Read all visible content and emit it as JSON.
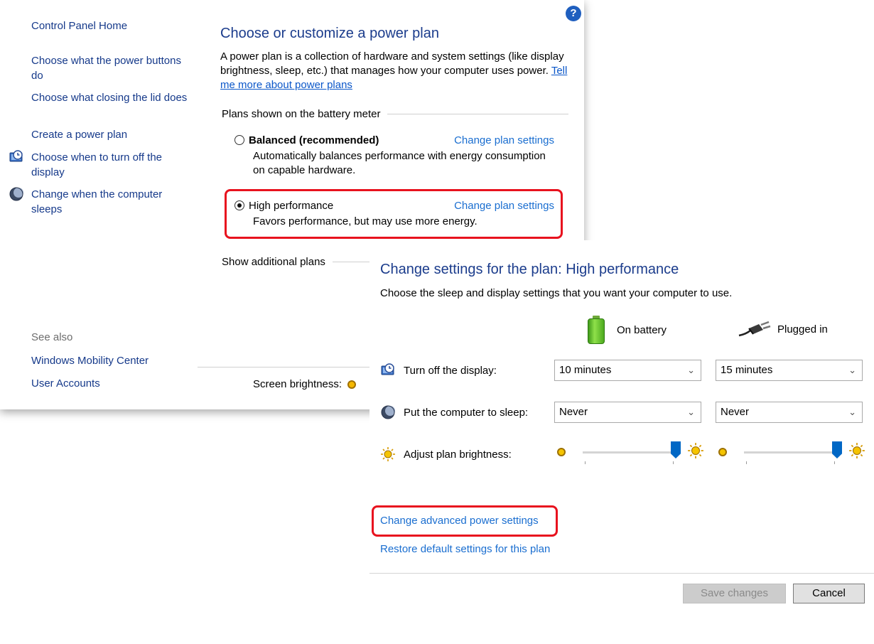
{
  "back_window": {
    "left_pane": {
      "home": "Control Panel Home",
      "items": [
        {
          "label": "Choose what the power buttons do",
          "icon": ""
        },
        {
          "label": "Choose what closing the lid does",
          "icon": ""
        },
        {
          "label": "Create a power plan",
          "icon": ""
        },
        {
          "label": "Choose when to turn off the display",
          "icon": "monitor-clock-icon"
        },
        {
          "label": "Change when the computer sleeps",
          "icon": "moon-icon"
        }
      ],
      "see_also": "See also",
      "see_also_links": [
        "Windows Mobility Center",
        "User Accounts"
      ]
    },
    "help_label": "?",
    "title": "Choose or customize a power plan",
    "description": "A power plan is a collection of hardware and system settings (like display brightness, sleep, etc.) that manages how your computer uses power.",
    "description_link": "Tell me more about power plans",
    "group_label": "Plans shown on the battery meter",
    "plans": [
      {
        "name": "Balanced (recommended)",
        "selected": false,
        "change_link": "Change plan settings",
        "description": "Automatically balances performance with energy consumption on capable hardware."
      },
      {
        "name": "High performance",
        "selected": true,
        "change_link": "Change plan settings",
        "description": "Favors performance, but may use more energy."
      }
    ],
    "show_additional": "Show additional plans",
    "screen_brightness_label": "Screen brightness:"
  },
  "front_window": {
    "title": "Change settings for the plan: High performance",
    "subtitle": "Choose the sleep and display settings that you want your computer to use.",
    "columns": {
      "battery": "On battery",
      "plugged": "Plugged in"
    },
    "rows": {
      "display": {
        "label": "Turn off the display:",
        "battery": "10 minutes",
        "plugged": "15 minutes",
        "icon": "monitor-clock-icon"
      },
      "sleep": {
        "label": "Put the computer to sleep:",
        "battery": "Never",
        "plugged": "Never",
        "icon": "moon-icon"
      },
      "brightness": {
        "label": "Adjust plan brightness:",
        "battery_level": 1.0,
        "plugged_level": 1.0,
        "icon": "sun-icon"
      }
    },
    "advanced_link": "Change advanced power settings",
    "restore_link": "Restore default settings for this plan",
    "save_button": "Save changes",
    "cancel_button": "Cancel"
  },
  "colors": {
    "highlight": "#e8121e",
    "link": "#1a6ed0",
    "title": "#1b3c8c"
  }
}
